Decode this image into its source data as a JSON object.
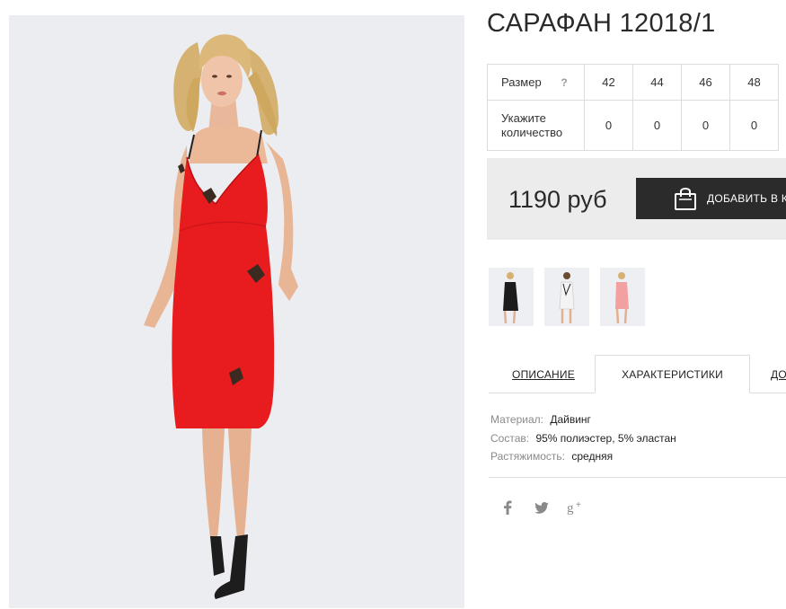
{
  "product": {
    "title": "САРАФАН 12018/1",
    "main_image": "woman-in-red-slip-dress"
  },
  "size_table": {
    "size_label": "Размер",
    "help_icon": "?",
    "qty_label": "Укажите количество",
    "sizes": [
      "42",
      "44",
      "46",
      "48"
    ],
    "quantities": [
      "0",
      "0",
      "0",
      "0"
    ]
  },
  "purchase": {
    "price": "1190 руб",
    "add_button_label": "ДОБАВИТЬ В КОРЗИНУ",
    "button_icon": "shopping-bag-icon"
  },
  "thumbnails": [
    {
      "name": "black-dress",
      "color": "#1c1c1c"
    },
    {
      "name": "white-dress",
      "color": "#f4f4f4"
    },
    {
      "name": "pink-dress",
      "color": "#f2a0a0"
    }
  ],
  "tabs": [
    {
      "label": "ОПИСАНИЕ",
      "active": false
    },
    {
      "label": "ХАРАКТЕРИСТИКИ",
      "active": true
    },
    {
      "label": "ДОСТАВКА",
      "active": false
    }
  ],
  "characteristics": [
    {
      "key": "Материал:",
      "value": "Дайвинг"
    },
    {
      "key": "Состав:",
      "value": "95% полиэстер, 5% эластан"
    },
    {
      "key": "Растяжимость:",
      "value": "средняя"
    }
  ],
  "social": [
    {
      "name": "facebook-icon",
      "glyph": "f"
    },
    {
      "name": "twitter-icon",
      "glyph": "t"
    },
    {
      "name": "google-plus-icon",
      "glyph": "g+"
    }
  ],
  "colors": {
    "dress_red": "#e81b1e",
    "button_dark": "#2b2b2b",
    "price_panel": "#ececec",
    "photo_bg": "#ecedf1"
  }
}
